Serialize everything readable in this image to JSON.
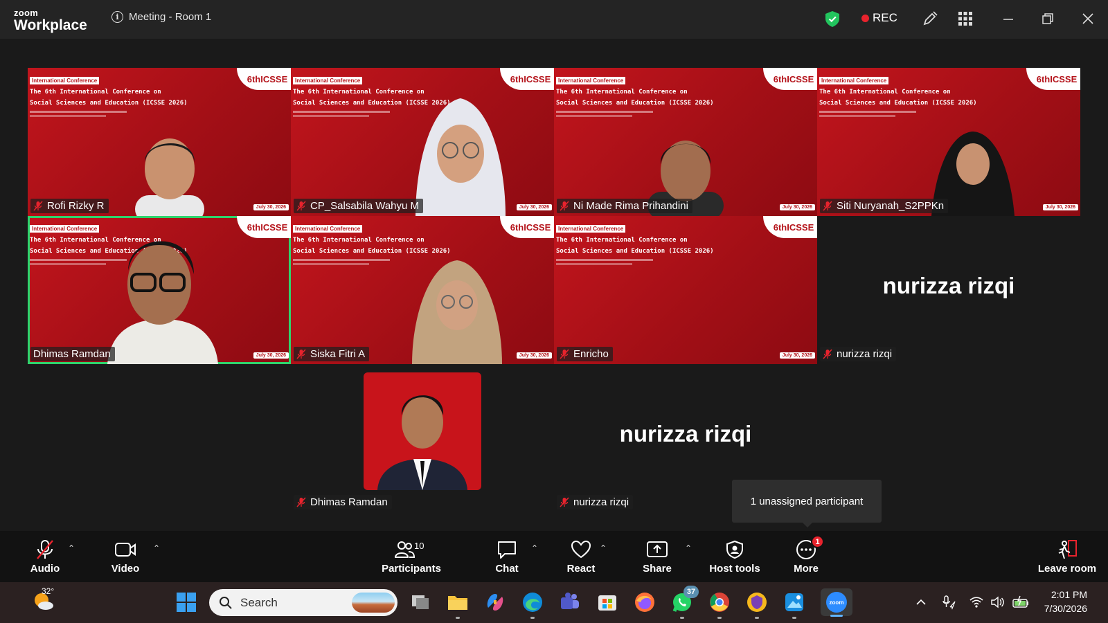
{
  "window": {
    "app_small": "zoom",
    "app_big": "Workplace",
    "meeting_title": "Meeting - Room 1",
    "rec_label": "REC"
  },
  "tiles": [
    {
      "name": "Rofi Rizky R"
    },
    {
      "name": "CP_Salsabila Wahyu M"
    },
    {
      "name": "Ni Made Rima Prihandini"
    },
    {
      "name": "Siti Nuryanah_S2PPKn"
    },
    {
      "name": "Dhimas Ramdan"
    },
    {
      "name": "Siska Fitri A"
    },
    {
      "name": "Enricho"
    },
    {
      "name": "nurizza rizqi",
      "display": "nurizza rizqi"
    },
    {
      "name": "Dhimas Ramdan"
    },
    {
      "name": "nurizza rizqi",
      "display": "nurizza rizqi"
    }
  ],
  "conference": {
    "badge": "International Conference",
    "title_line1": "The 6th International Conference on",
    "title_line2": "Social Sciences and Education (ICSSE 2026)",
    "logo": "6thICSSE",
    "date": "July 30, 2026"
  },
  "tooltip": "1 unassigned participant",
  "controls": {
    "audio": "Audio",
    "video": "Video",
    "participants": "Participants",
    "participants_count": "10",
    "chat": "Chat",
    "react": "React",
    "share": "Share",
    "host_tools": "Host tools",
    "more": "More",
    "more_badge": "1",
    "leave": "Leave room"
  },
  "taskbar": {
    "temperature": "32°",
    "search_placeholder": "Search",
    "whatsapp_badge": "37",
    "time": "2:01 PM",
    "date": "7/30/2026"
  },
  "colors": {
    "active_speaker": "#2fd36c",
    "rec_dot": "#e8232d",
    "conference_red": "#b5141b"
  }
}
